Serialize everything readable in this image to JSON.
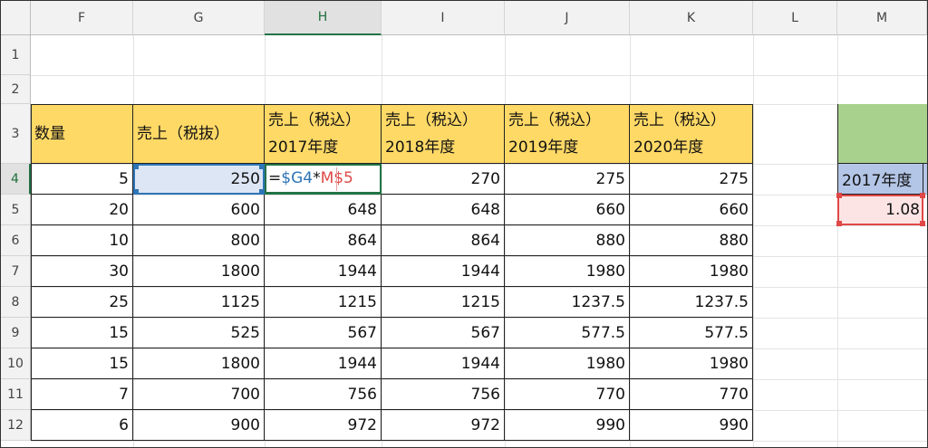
{
  "column_headers": [
    "F",
    "G",
    "H",
    "I",
    "J",
    "K",
    "L",
    "M"
  ],
  "row_headers": [
    "1",
    "2",
    "3",
    "4",
    "5",
    "6",
    "7",
    "8",
    "9",
    "10",
    "11",
    "12"
  ],
  "table": {
    "headers": [
      {
        "line1": "数量",
        "line2": ""
      },
      {
        "line1": "売上（税抜）",
        "line2": ""
      },
      {
        "line1": "売上（税込）",
        "line2": "2017年度"
      },
      {
        "line1": "売上（税込）",
        "line2": "2018年度"
      },
      {
        "line1": "売上（税込）",
        "line2": "2019年度"
      },
      {
        "line1": "売上（税込）",
        "line2": "2020年度"
      }
    ],
    "rows": [
      [
        "5",
        "250",
        "",
        "270",
        "275",
        "275"
      ],
      [
        "20",
        "600",
        "648",
        "648",
        "660",
        "660"
      ],
      [
        "10",
        "800",
        "864",
        "864",
        "880",
        "880"
      ],
      [
        "30",
        "1800",
        "1944",
        "1944",
        "1980",
        "1980"
      ],
      [
        "25",
        "1125",
        "1215",
        "1215",
        "1237.5",
        "1237.5"
      ],
      [
        "15",
        "525",
        "567",
        "567",
        "577.5",
        "577.5"
      ],
      [
        "15",
        "1800",
        "1944",
        "1944",
        "1980",
        "1980"
      ],
      [
        "7",
        "700",
        "756",
        "756",
        "770",
        "770"
      ],
      [
        "6",
        "900",
        "972",
        "972",
        "990",
        "990"
      ]
    ]
  },
  "formula": {
    "eq": "=",
    "ref1": "$G4",
    "op": "*",
    "ref2": "M$5"
  },
  "side_table": {
    "header": "2017年度",
    "value": "1.08"
  },
  "colors": {
    "header_fill": "#ffd966",
    "side_top_fill": "#a9d18e",
    "side_header_fill": "#b4c6e7",
    "active_cell_border": "#217346",
    "ref1_color": "#2e75b6",
    "ref2_color": "#e04848"
  }
}
